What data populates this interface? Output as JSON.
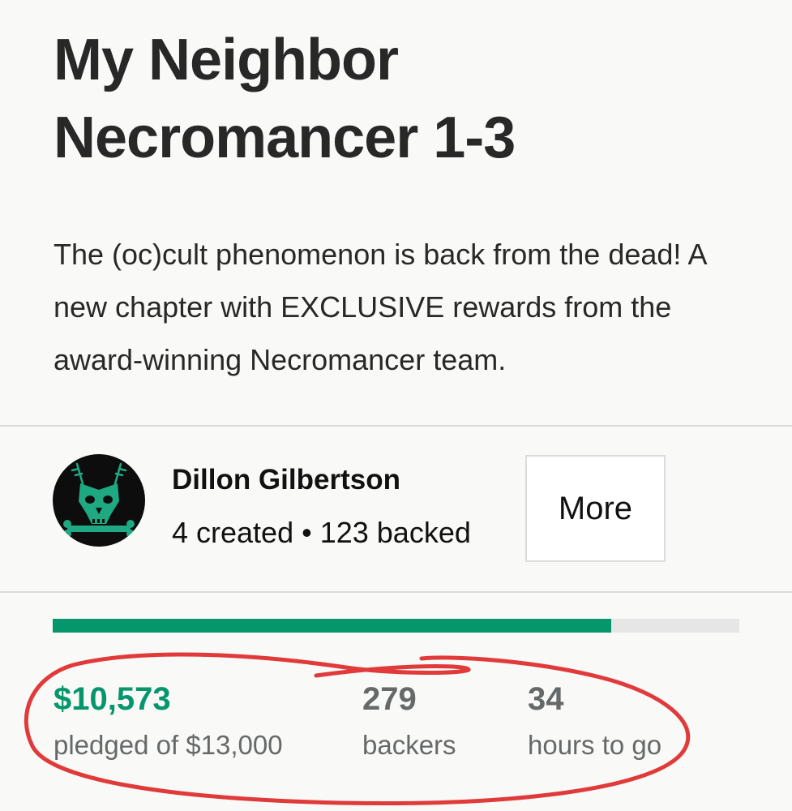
{
  "project": {
    "title": "My Neighbor Necromancer 1-3",
    "blurb": "The (oc)cult phenomenon is back from the dead! A new chapter with EXCLUSIVE rewards from the award-winning Necromancer team."
  },
  "creator": {
    "name": "Dillon Gilbertson",
    "stats": "4 created • 123 backed",
    "avatar_icon": "wolf-skull-icon",
    "more_label": "More"
  },
  "funding": {
    "progress_fraction": 0.813,
    "pledged_value": "$10,573",
    "pledged_label": "pledged of $13,000",
    "backers_value": "279",
    "backers_label": "backers",
    "time_value": "34",
    "time_label": "hours to go"
  },
  "colors": {
    "accent_green": "#05966c",
    "annotation_red": "#e03a3a"
  }
}
